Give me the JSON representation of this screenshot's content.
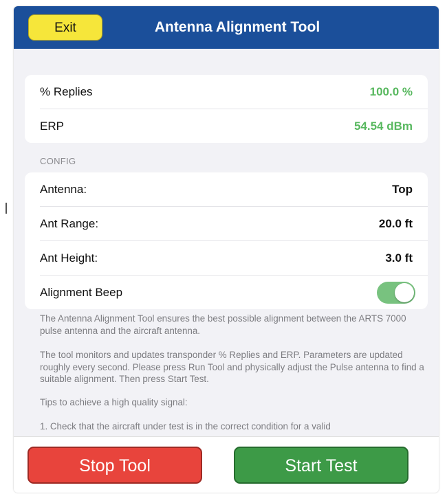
{
  "header": {
    "exit_label": "Exit",
    "title": "Antenna Alignment Tool"
  },
  "readings": [
    {
      "label": "% Replies",
      "value": "100.0 %"
    },
    {
      "label": "ERP",
      "value": "54.54 dBm"
    }
  ],
  "config": {
    "section_label": "CONFIG",
    "rows": [
      {
        "label": "Antenna:",
        "value": "Top"
      },
      {
        "label": "Ant Range:",
        "value": "20.0 ft"
      },
      {
        "label": "Ant Height:",
        "value": "3.0 ft"
      }
    ],
    "beep_label": "Alignment Beep",
    "beep_on": true
  },
  "description": {
    "p1": "The Antenna Alignment Tool ensures the best possible alignment between the ARTS 7000 pulse antenna and the aircraft antenna.",
    "p2": "The tool monitors and updates transponder % Replies and ERP. Parameters are updated roughly every second. Please press Run Tool and physically adjust the Pulse antenna to find a suitable alignment. Then press Start Test.",
    "p3": "Tips to achieve a high quality signal:",
    "p4": "1. Check that the aircraft under test is in the correct condition for a valid"
  },
  "footer": {
    "stop_label": "Stop Tool",
    "start_label": "Start Test"
  },
  "colors": {
    "header_bg": "#1b4f9a",
    "exit_bg": "#f6e63a",
    "value_green": "#58b85f",
    "toggle_on": "#78c27f",
    "stop_bg": "#e8443c",
    "start_bg": "#3d9a47"
  }
}
